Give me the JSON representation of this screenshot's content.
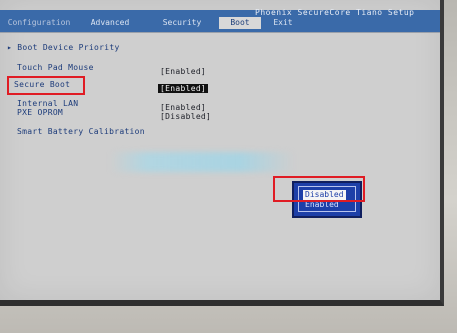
{
  "header": {
    "brand": "Phoenix SecureCore Tiano Setup",
    "tabs": [
      "Configuration",
      "Advanced",
      "Security",
      "Boot",
      "Exit"
    ],
    "active_tab": "Boot"
  },
  "boot": {
    "boot_device_priority": "▸ Boot Device Priority",
    "items": [
      {
        "label": "Touch Pad Mouse",
        "value": "[Enabled]"
      },
      {
        "label": "Secure Boot",
        "value": "[Enabled]"
      },
      {
        "label": "Internal LAN",
        "value": "[Enabled]"
      },
      {
        "label": "PXE OPROM",
        "value": "[Disabled]"
      },
      {
        "label": "Smart Battery Calibration",
        "value": ""
      }
    ]
  },
  "popup": {
    "options": [
      "Disabled",
      "Enabled"
    ],
    "highlighted": "Disabled"
  },
  "colors": {
    "header_bg": "#3a6aa9",
    "screen_bg": "#cfcfcf",
    "label": "#1c3b7a",
    "popup_bg": "#1d3fa8",
    "annotation_red": "#e01c24"
  }
}
